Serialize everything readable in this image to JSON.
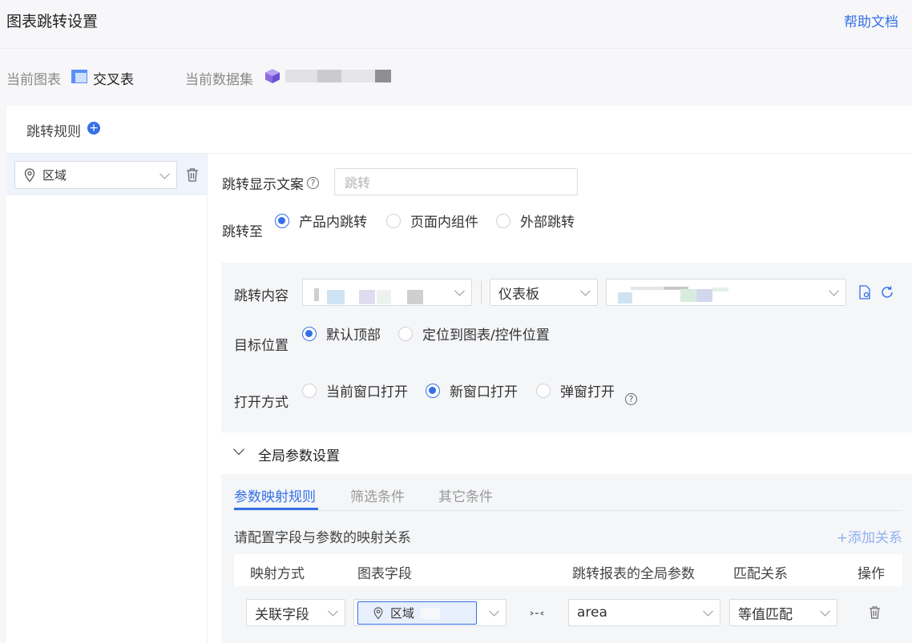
{
  "header": {
    "title": "图表跳转设置",
    "help_link": "帮助文档"
  },
  "meta": {
    "chart_label": "当前图表",
    "chart_value": "交叉表",
    "dataset_label": "当前数据集"
  },
  "rules": {
    "title": "跳转规则",
    "items": [
      {
        "field": "区域"
      }
    ]
  },
  "form": {
    "display_text_label": "跳转显示文案",
    "display_text_placeholder": "跳转",
    "jump_to_label": "跳转至",
    "jump_to_options": [
      "产品内跳转",
      "页面内组件",
      "外部跳转"
    ],
    "content_label": "跳转内容",
    "content_type": "仪表板",
    "target_label": "目标位置",
    "target_options": [
      "默认顶部",
      "定位到图表/控件位置"
    ],
    "open_label": "打开方式",
    "open_options": [
      "当前窗口打开",
      "新窗口打开",
      "弹窗打开"
    ]
  },
  "global_params": {
    "title": "全局参数设置",
    "tabs": [
      "参数映射规则",
      "筛选条件",
      "其它条件"
    ],
    "hint": "请配置字段与参数的映射关系",
    "add_link": "+添加关系",
    "columns": [
      "映射方式",
      "图表字段",
      "跳转报表的全局参数",
      "匹配关系",
      "操作"
    ],
    "rows": [
      {
        "mapping": "关联字段",
        "field": "区域",
        "param": "area",
        "match": "等值匹配"
      }
    ]
  },
  "colors": {
    "accent": "#3570e8"
  }
}
